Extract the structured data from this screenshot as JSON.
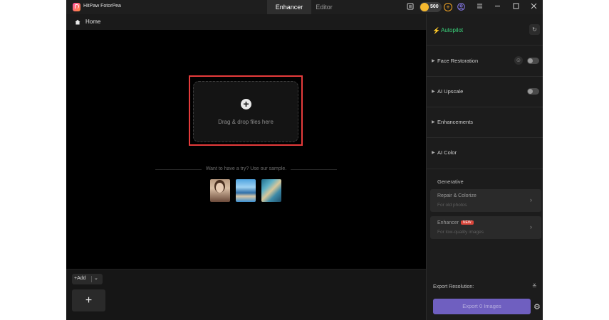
{
  "app": {
    "title": "HitPaw FotorPea"
  },
  "tabs": [
    {
      "label": "Enhancer"
    },
    {
      "label": "Editor"
    }
  ],
  "titlebar": {
    "credits": "500"
  },
  "breadcrumb": {
    "home_label": "Home"
  },
  "dropzone": {
    "label": "Drag & drop files here"
  },
  "samples": {
    "prompt": "Want to have a try? Use our sample."
  },
  "bottombar": {
    "add_label": "Add"
  },
  "panel": {
    "autopilot_label": "Autopilot",
    "sections": [
      {
        "label": "Face Restoration",
        "toggle": "off"
      },
      {
        "label": "AI Upscale",
        "toggle": "off"
      },
      {
        "label": "Enhancements"
      },
      {
        "label": "AI Color"
      }
    ],
    "generative": {
      "heading": "Generative",
      "cards": [
        {
          "title": "Repair & Colorize",
          "subtitle": "For old photos"
        },
        {
          "title": "Enhancer",
          "badge": "NEW",
          "subtitle": "For low-quality images"
        }
      ]
    },
    "export_resolution_label": "Export Resolution:",
    "export_button_label": "Export 0 Images"
  },
  "colors": {
    "accent": "#6f5fc0",
    "autopilot": "#3ad17a",
    "highlight": "#e63b3b"
  }
}
